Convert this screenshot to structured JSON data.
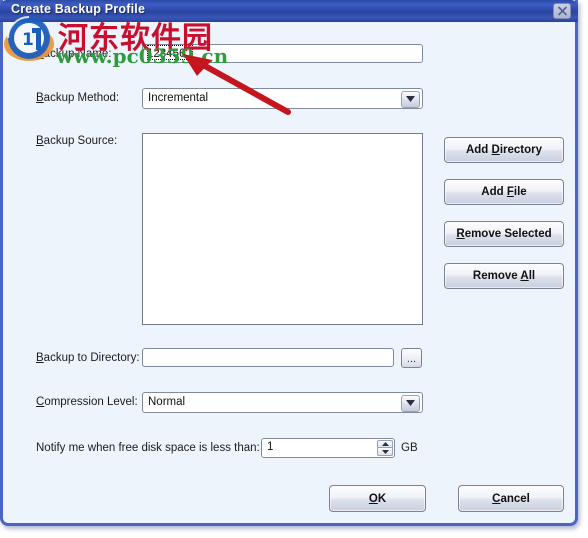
{
  "window": {
    "title": "Create Backup Profile",
    "close_icon": "close-icon"
  },
  "watermark": {
    "site_name_cn": "河东软件园",
    "site_url": "www.pc0359.cn",
    "logo_icon": "site-logo-icon"
  },
  "form": {
    "backup_name": {
      "label": "Backup Name:",
      "accel": "B",
      "label_rest": "ackup Name:",
      "value": "123456"
    },
    "backup_method": {
      "label_accel": "B",
      "label_rest": "ackup Method:",
      "value": "Incremental",
      "arrow_icon": "chevron-down-icon"
    },
    "backup_source": {
      "label_accel": "B",
      "label_rest": "ackup Source:",
      "items": []
    },
    "backup_to_directory": {
      "label_accel": "B",
      "label_rest": "ackup to Directory:",
      "value": "",
      "browse_label": "...",
      "browse_icon": "ellipsis-icon"
    },
    "compression_level": {
      "label_accel": "C",
      "label_rest": "ompression Level:",
      "value": "Normal",
      "arrow_icon": "chevron-down-icon"
    },
    "free_disk_notify": {
      "label": "Notify me when free disk space is less than:",
      "value": "1",
      "unit": "GB",
      "up_icon": "spinner-up-icon",
      "down_icon": "spinner-down-icon"
    }
  },
  "source_buttons": [
    {
      "name": "add-directory-button",
      "accel": "D",
      "pre": "Add ",
      "rest": "irectory"
    },
    {
      "name": "add-file-button",
      "accel": "F",
      "pre": "Add ",
      "rest": "ile"
    },
    {
      "name": "remove-selected-button",
      "accel": "R",
      "pre": "",
      "rest": "emove Selected"
    },
    {
      "name": "remove-all-button",
      "accel": "A",
      "pre": "Remove ",
      "rest": "ll"
    }
  ],
  "dialog_buttons": {
    "ok": {
      "accel": "O",
      "pre": "",
      "rest": "K"
    },
    "cancel": {
      "accel": "C",
      "pre": "",
      "rest": "ancel"
    }
  },
  "annotation": {
    "arrow_icon": "red-arrow-pointer",
    "color": "#c4161c"
  },
  "colors": {
    "titlebar_blue": "#2b45a0",
    "dialog_border": "#4a66c0",
    "dialog_bg": "#eef4fc",
    "watermark_red": "#c8102e",
    "watermark_green": "#2e9b3f"
  }
}
